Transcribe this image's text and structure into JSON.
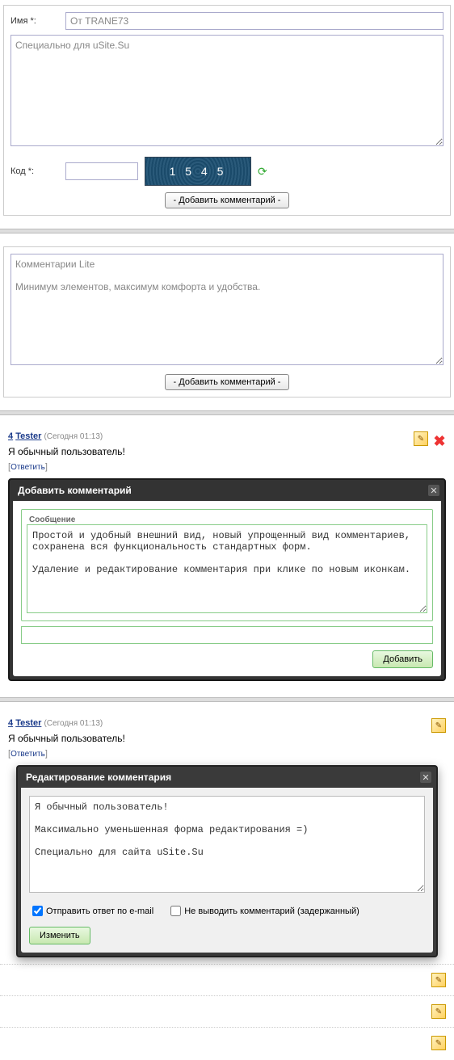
{
  "form1": {
    "name_label": "Имя *:",
    "name_value": "От TRANE73",
    "message_value": "Специально для uSite.Su",
    "code_label": "Код *:",
    "captcha_text": "1 5 4 5",
    "submit": "- Добавить комментарий -"
  },
  "form2": {
    "message_value": "Комментарии Lite\n\nМинимум элементов, максимум комфорта и удобства.",
    "submit": "- Добавить комментарий -"
  },
  "comment1": {
    "num": "4",
    "user": "Tester",
    "date": "(Сегодня 01:13)",
    "text": "Я обычный пользователь!",
    "reply": "Ответить"
  },
  "add_modal": {
    "title": "Добавить комментарий",
    "legend": "Сообщение",
    "text": "Простой и удобный внешний вид, новый упрощенный вид комментариев, сохранена вся функциональность стандартных форм.\n\nУдаление и редактирование комментария при клике по новым иконкам.",
    "submit": "Добавить"
  },
  "comment2": {
    "num": "4",
    "user": "Tester",
    "date": "(Сегодня 01:13)",
    "text": "Я обычный пользователь!",
    "reply": "Ответить"
  },
  "edit_modal": {
    "title": "Редактирование комментария",
    "text": "Я обычный пользователь!\n\nМаксимально уменьшенная форма редактирования =)\n\nСпециально для сайта uSite.Su",
    "email_label": "Отправить ответ по e-mail",
    "hide_label": "Не выводить комментарий (задержанный)",
    "submit": "Изменить"
  }
}
